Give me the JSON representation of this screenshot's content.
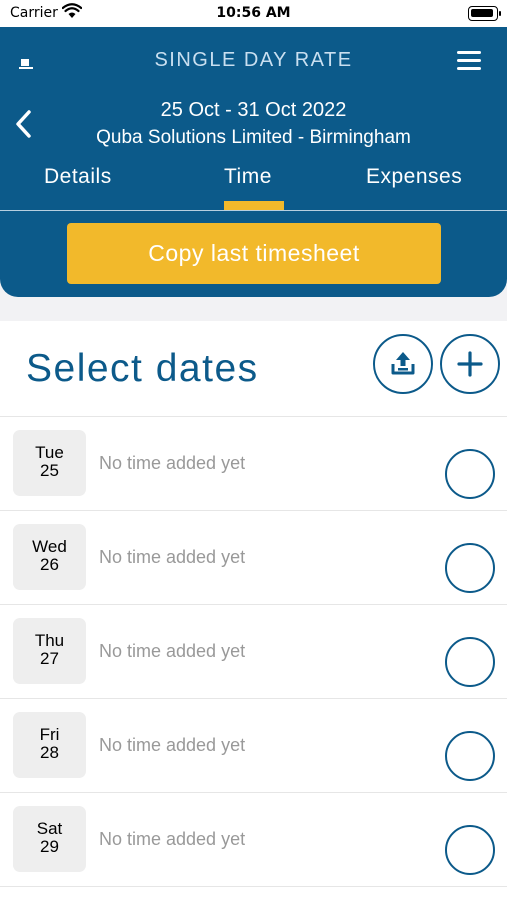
{
  "status_bar": {
    "carrier": "Carrier",
    "time": "10:56 AM"
  },
  "header": {
    "title": "SINGLE DAY RATE",
    "date_range": "25 Oct - 31 Oct 2022",
    "company": "Quba Solutions Limited - Birmingham",
    "tabs": [
      {
        "label": "Details",
        "active": false
      },
      {
        "label": "Time",
        "active": true
      },
      {
        "label": "Expenses",
        "active": false
      }
    ],
    "copy_button_label": "Copy last timesheet"
  },
  "main": {
    "title": "Select dates",
    "days": [
      {
        "weekday": "Tue",
        "day": "25",
        "status": "No time added yet"
      },
      {
        "weekday": "Wed",
        "day": "26",
        "status": "No time added yet"
      },
      {
        "weekday": "Thu",
        "day": "27",
        "status": "No time added yet"
      },
      {
        "weekday": "Fri",
        "day": "28",
        "status": "No time added yet"
      },
      {
        "weekday": "Sat",
        "day": "29",
        "status": "No time added yet"
      }
    ]
  },
  "colors": {
    "brand": "#0c5a8a",
    "accent": "#f2b92b",
    "muted_text": "#999999"
  },
  "icons": [
    "wifi-icon",
    "battery-icon",
    "logo-icon",
    "menu-icon",
    "back-icon",
    "upload-icon",
    "plus-icon"
  ]
}
